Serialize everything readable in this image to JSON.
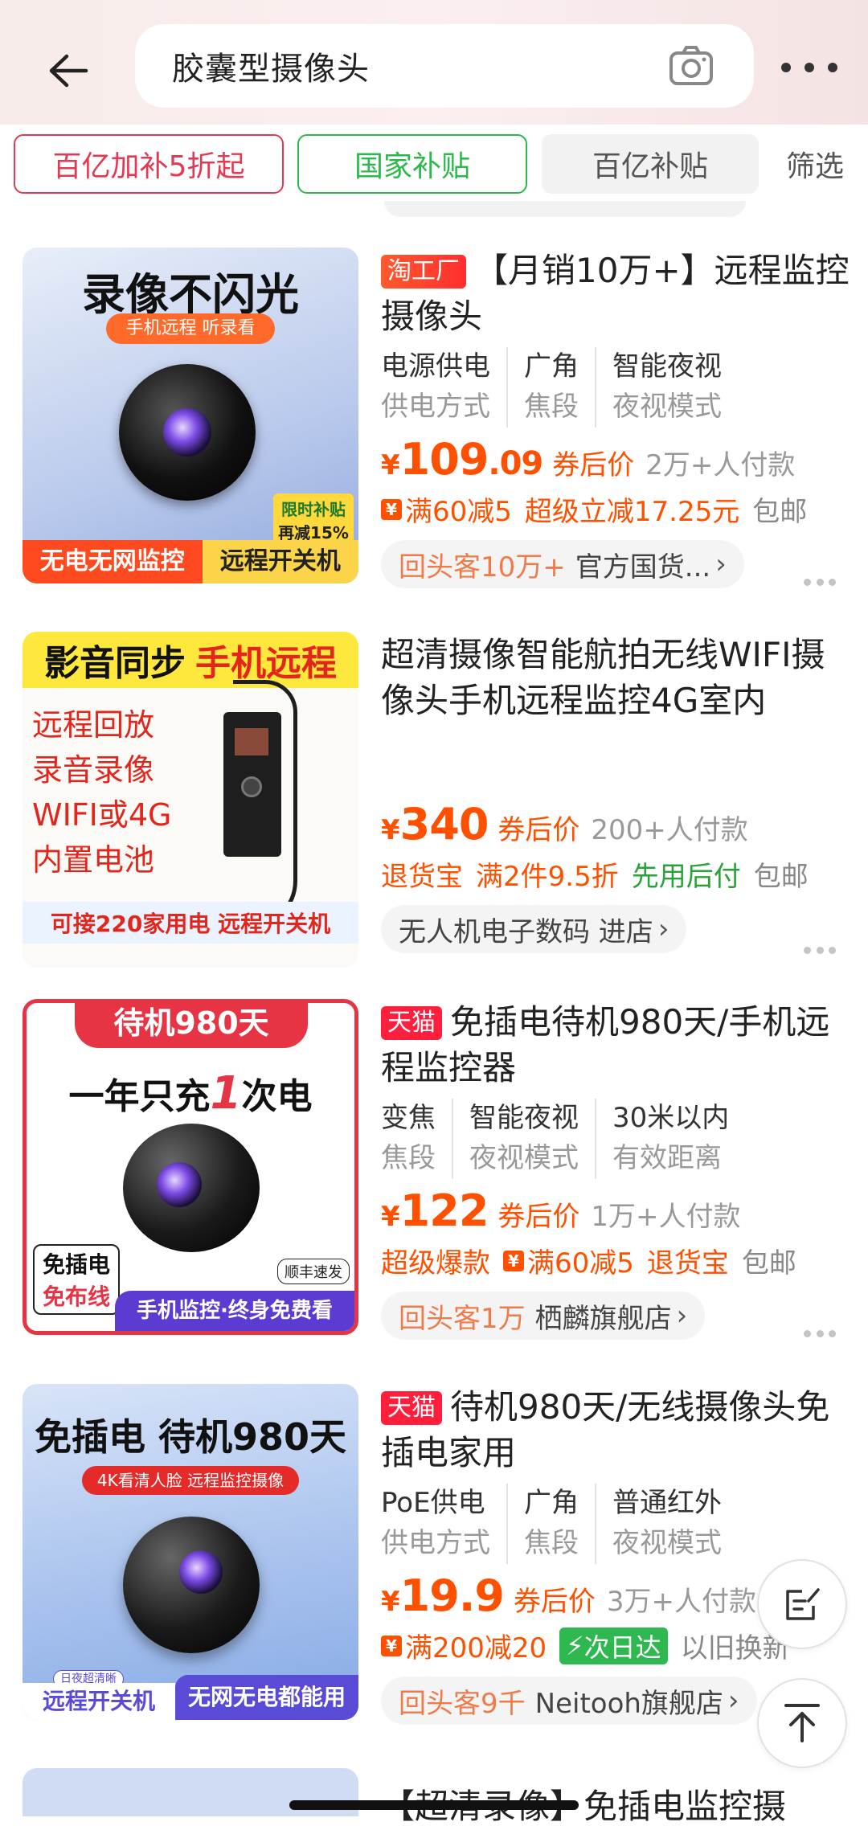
{
  "header": {
    "search_query": "胶囊型摄像头"
  },
  "filters": {
    "chips": [
      "百亿加补5折起",
      "国家补贴",
      "百亿补贴"
    ],
    "filter_label": "筛选"
  },
  "products": [
    {
      "badge": "淘工厂",
      "title": "【月销10万+】远程监控摄像头",
      "specs": [
        {
          "value": "电源供电",
          "label": "供电方式"
        },
        {
          "value": "广角",
          "label": "焦段"
        },
        {
          "value": "智能夜视",
          "label": "夜视模式"
        }
      ],
      "price_int": "109",
      "price_dec": ".09",
      "after_coupon": "券后价",
      "buyers": "2万+人付款",
      "promos": [
        "满60减5",
        "超级立减17.25元",
        "包邮"
      ],
      "shop_tag": "回头客10万+",
      "shop_name": "官方国货...",
      "thumb": {
        "headline": "录像不闪光",
        "pill": "手机远程 听录看",
        "tag1": "限时补贴",
        "tag2": "再减15%",
        "bottom_left": "无电无网监控",
        "bottom_right": "远程开关机"
      }
    },
    {
      "badge": "",
      "title": "超清摄像智能航拍无线WIFI摄像头手机远程监控4G室内",
      "price_int": "340",
      "price_dec": "",
      "after_coupon": "券后价",
      "buyers": "200+人付款",
      "promos": [
        "退货宝",
        "满2件9.5折",
        "先用后付",
        "包邮"
      ],
      "shop_tag": "",
      "shop_name": "无人机电子数码 进店",
      "thumb": {
        "headline_a": "影音同步",
        "headline_b": "手机远程",
        "lines": [
          "远程回放",
          "录音录像",
          "WIFI或4G",
          "内置电池"
        ],
        "bottom": "可接220家用电 远程开关机"
      }
    },
    {
      "badge": "天猫",
      "title": "免插电待机980天/手机远程监控器",
      "specs": [
        {
          "value": "变焦",
          "label": "焦段"
        },
        {
          "value": "智能夜视",
          "label": "夜视模式"
        },
        {
          "value": "30米以内",
          "label": "有效距离"
        }
      ],
      "price_int": "122",
      "price_dec": "",
      "after_coupon": "券后价",
      "buyers": "1万+人付款",
      "promos": [
        "超级爆款",
        "满60减5",
        "退货宝",
        "包邮"
      ],
      "shop_tag": "回头客1万",
      "shop_name": "栖麟旗舰店",
      "thumb": {
        "top": "待机980天",
        "headline_a": "一年只充",
        "headline_num": "1",
        "headline_b": "次电",
        "side_a": "免插电",
        "side_b": "免布线",
        "sf": "顺丰速发",
        "bottom": "手机监控·终身免费看"
      }
    },
    {
      "badge": "天猫",
      "title": "待机980天/无线摄像头免插电家用",
      "specs": [
        {
          "value": "PoE供电",
          "label": "供电方式"
        },
        {
          "value": "广角",
          "label": "焦段"
        },
        {
          "value": "普通红外",
          "label": "夜视模式"
        }
      ],
      "price_int": "19",
      "price_dec": ".9",
      "after_coupon": "券后价",
      "buyers": "3万+人付款",
      "promos": [
        "满200减20",
        "次日达",
        "以旧换新"
      ],
      "shop_tag": "回头客9千",
      "shop_name": "Neitooh旗舰店",
      "thumb": {
        "headline": "免插电 待机980天",
        "pill": "4K看清人脸 远程监控摄像",
        "small": "日夜超清晰",
        "bottom_left": "远程开关机",
        "bottom_right": "无网无电都能用"
      }
    }
  ],
  "partial_next": {
    "title": "【超清录像】免插电监控摄"
  },
  "colors": {
    "accent_orange": "#ff5000",
    "tmall_red": "#ff1f3d",
    "green": "#2db84d"
  },
  "icons": [
    "back-arrow-icon",
    "camera-icon",
    "more-icon",
    "feedback-icon",
    "back-to-top-icon"
  ]
}
